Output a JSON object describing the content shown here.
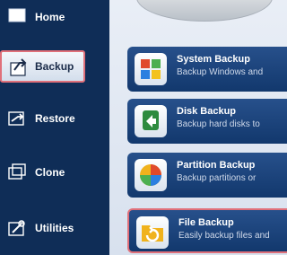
{
  "nav": {
    "items": [
      {
        "label": "Home"
      },
      {
        "label": "Backup"
      },
      {
        "label": "Restore"
      },
      {
        "label": "Clone"
      },
      {
        "label": "Utilities"
      }
    ]
  },
  "cards": [
    {
      "title": "System Backup",
      "desc": "Backup Windows and"
    },
    {
      "title": "Disk Backup",
      "desc": "Backup hard disks to"
    },
    {
      "title": "Partition Backup",
      "desc": "Backup partitions or"
    },
    {
      "title": "File Backup",
      "desc": "Easily backup files and"
    }
  ],
  "colors": {
    "nav_bg": "#0f2d57",
    "card_bg": "#27508b",
    "highlight": "#e0707a"
  }
}
